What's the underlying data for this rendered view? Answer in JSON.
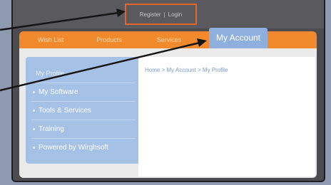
{
  "header": {
    "register_label": "Register",
    "separator": "|",
    "login_label": "Login"
  },
  "nav": {
    "tabs": [
      {
        "label": "Wish List"
      },
      {
        "label": "Products"
      },
      {
        "label": "Services"
      },
      {
        "label": "My Account",
        "active": true
      }
    ]
  },
  "sidebar": {
    "heading": "My Profile",
    "items": [
      {
        "label": "My Software"
      },
      {
        "label": "Tools & Services"
      },
      {
        "label": "Training"
      },
      {
        "label": "Powered by Wirghsoft"
      }
    ]
  },
  "breadcrumb": {
    "text": "Home > My Account > My Profile"
  },
  "colors": {
    "nav_bar": "#f08a2c",
    "active_tab": "#8fb0de",
    "sidebar": "#a6c1e6",
    "highlight_box": "#e0682a",
    "arrow": "#151515"
  }
}
